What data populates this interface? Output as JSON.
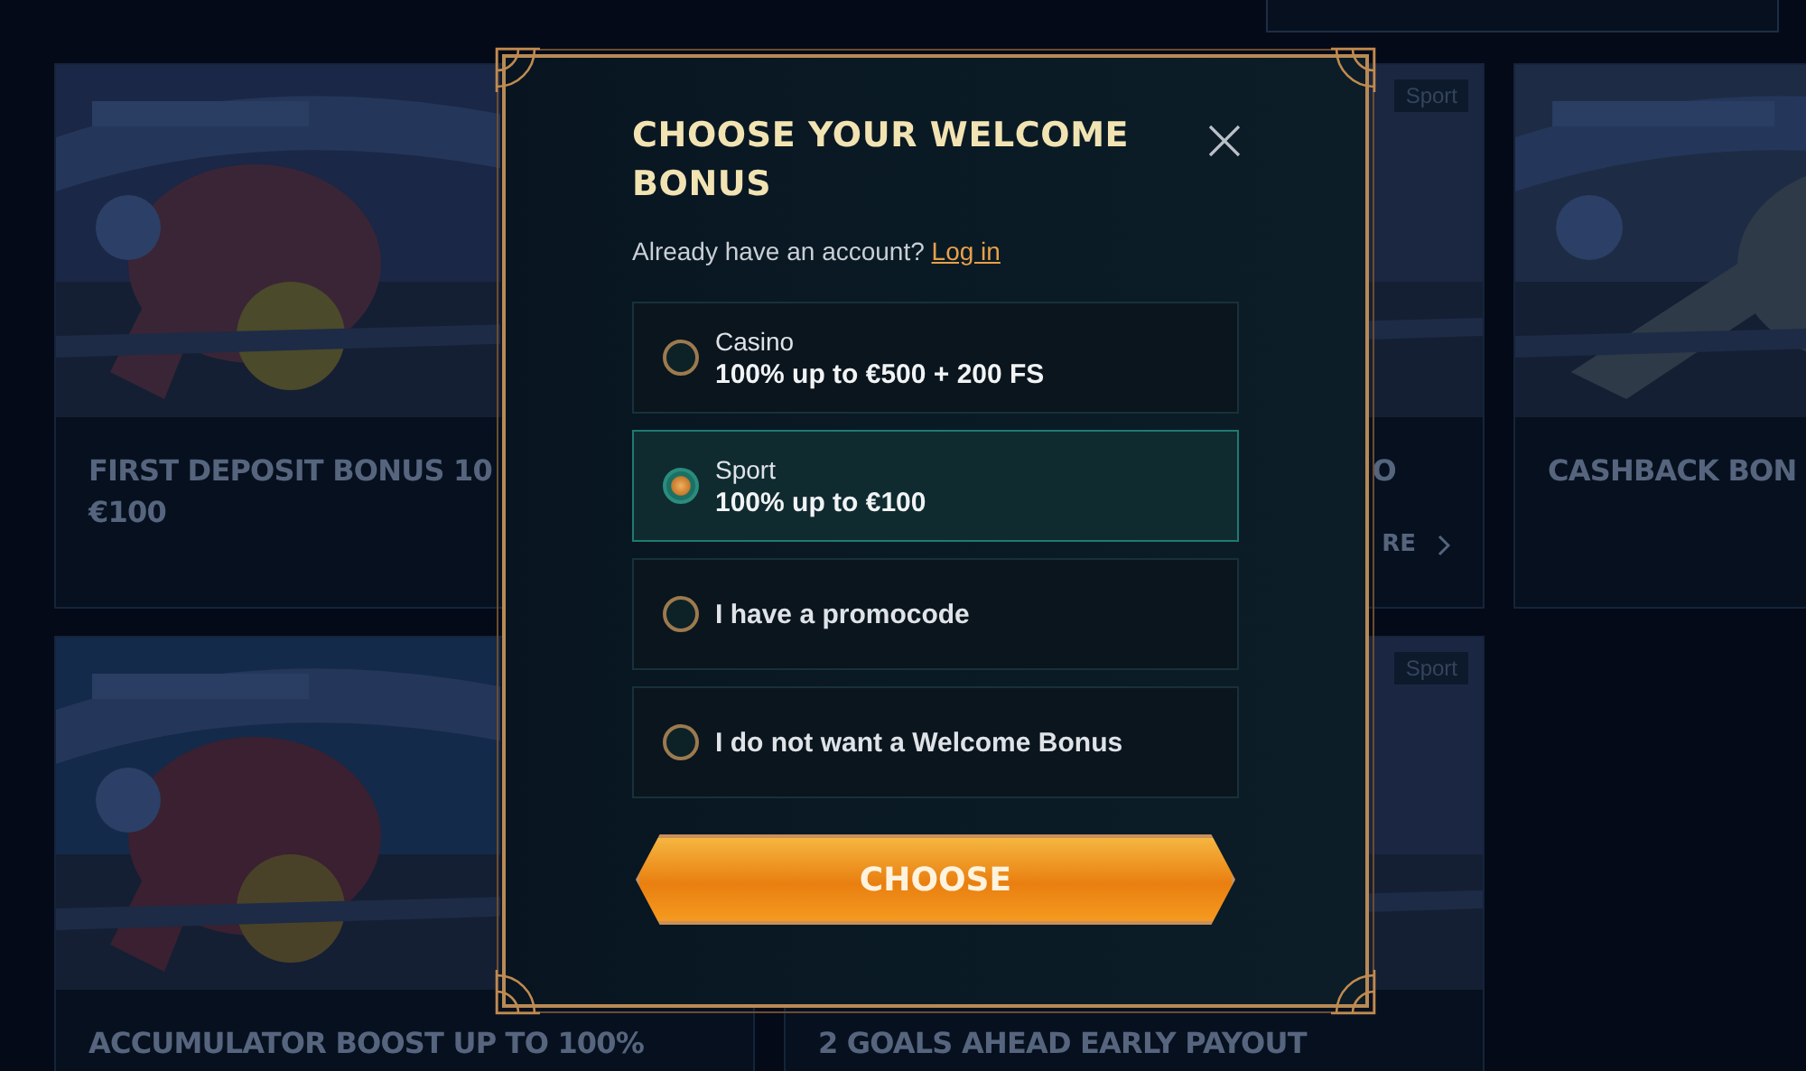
{
  "promos": [
    {
      "lines": [
        "FIRST DEPOSIT BONUS 10",
        "€100"
      ]
    },
    {
      "kind": "cut",
      "badge": "Sport",
      "lines": [
        "O"
      ],
      "link": "RE"
    },
    {
      "lines": [
        "CASHBACK BON"
      ]
    },
    {
      "lines": [
        "ACCUMULATOR BOOST UP TO 100%"
      ]
    },
    {
      "badge": "Sport",
      "lines": [
        "2 GOALS AHEAD EARLY PAYOUT"
      ]
    }
  ],
  "dialog": {
    "title": "CHOOSE YOUR WELCOME BONUS",
    "prompt": "Already have an account?",
    "login_link": "Log in",
    "options": [
      {
        "label": "Casino",
        "detail": "100% up to €500 + 200 FS",
        "selected": false
      },
      {
        "label": "Sport",
        "detail": "100% up to €100",
        "selected": true
      },
      {
        "label": "I have a promocode",
        "selected": false
      },
      {
        "label": "I do not want a Welcome Bonus",
        "selected": false
      }
    ],
    "button": "CHOOSE"
  }
}
